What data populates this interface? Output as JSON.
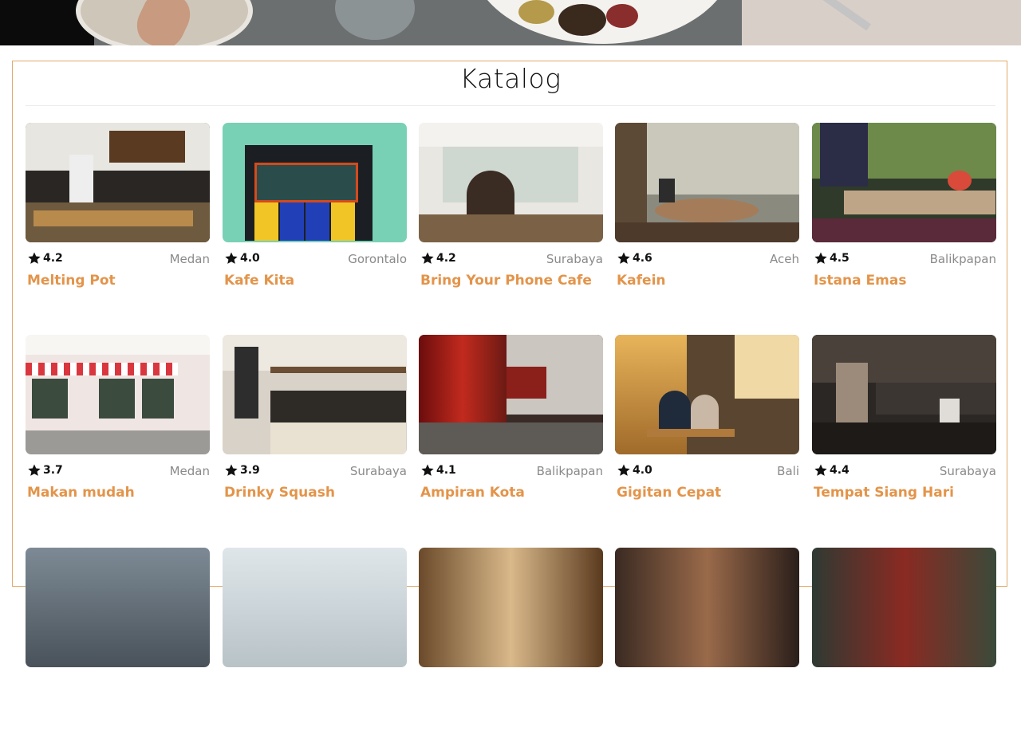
{
  "hero": {
    "image": "breakfast-table-photo"
  },
  "catalog": {
    "title": "Katalog",
    "items": [
      {
        "name": "Melting Pot",
        "rating": "4.2",
        "city": "Medan",
        "image": "cafe-kitchen-photo"
      },
      {
        "name": "Kafe Kita",
        "rating": "4.0",
        "city": "Gorontalo",
        "image": "colorful-window-photo"
      },
      {
        "name": "Bring Your Phone Cafe",
        "rating": "4.2",
        "city": "Surabaya",
        "image": "cafe-interior-man-photo"
      },
      {
        "name": "Kafein",
        "rating": "4.6",
        "city": "Aceh",
        "image": "glasshouse-table-photo"
      },
      {
        "name": "Istana Emas",
        "rating": "4.5",
        "city": "Balikpapan",
        "image": "garden-terrace-photo"
      },
      {
        "name": "Makan mudah",
        "rating": "3.7",
        "city": "Medan",
        "image": "shopfront-awning-photo"
      },
      {
        "name": "Drinky Squash",
        "rating": "3.9",
        "city": "Surabaya",
        "image": "coffee-bar-photo"
      },
      {
        "name": "Ampiran Kota",
        "rating": "4.1",
        "city": "Balikpapan",
        "image": "london-street-photo"
      },
      {
        "name": "Gigitan Cepat",
        "rating": "4.0",
        "city": "Bali",
        "image": "outdoor-diners-photo"
      },
      {
        "name": "Tempat Siang Hari",
        "rating": "4.4",
        "city": "Surabaya",
        "image": "chef-kitchen-photo"
      }
    ],
    "third_row_images": [
      "street-photo",
      "bright-interior-photo",
      "ornate-interior-photo",
      "rustic-bar-photo",
      "storefront-photo"
    ]
  },
  "colors": {
    "accent": "#e3944a",
    "border": "#e2a96a",
    "muted": "#8a8a8a"
  },
  "icons": {
    "rating": "star-icon"
  }
}
